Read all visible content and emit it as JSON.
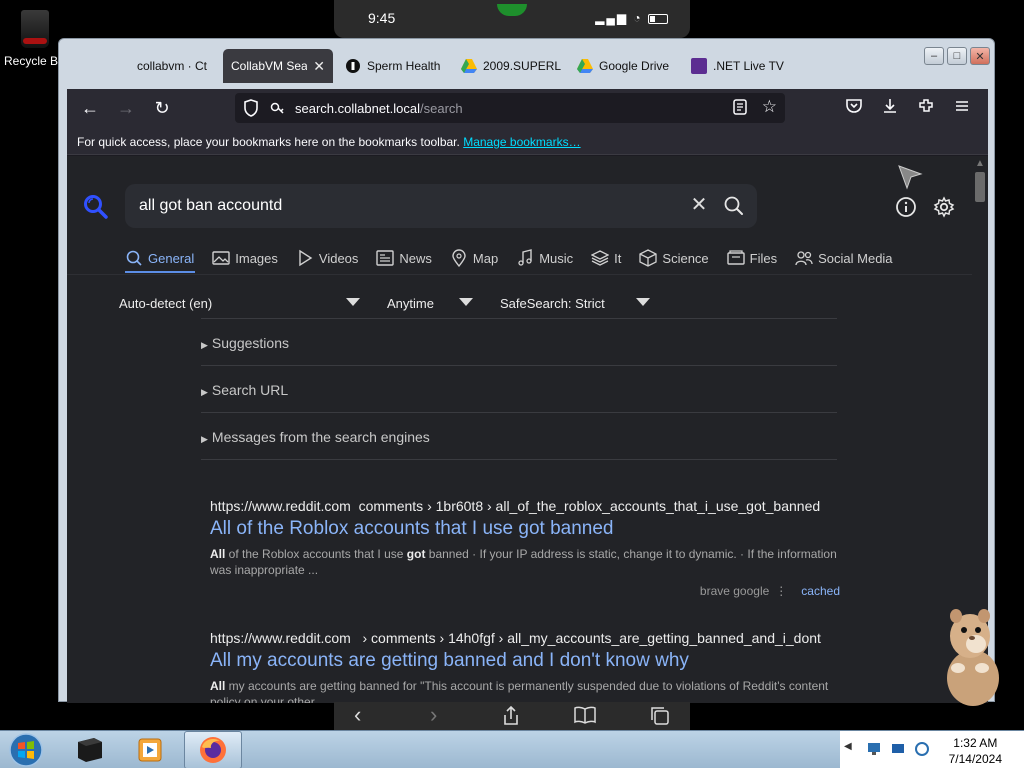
{
  "desktop": {
    "recycle_label": "Recycle Bin"
  },
  "phone": {
    "time": "9:45",
    "signal": "▂▄▆ ◔"
  },
  "tabs": [
    {
      "label": "collabvm · Ct",
      "icon": "user-icon"
    },
    {
      "label": "CollabVM Sear",
      "icon": "none"
    },
    {
      "label": "Sperm Health",
      "icon": "health-icon"
    },
    {
      "label": "2009.SUPERL",
      "icon": "google-drive-icon"
    },
    {
      "label": "Google Drive",
      "icon": "google-drive-icon"
    },
    {
      "label": ".NET Live TV",
      "icon": "net-icon"
    }
  ],
  "window_controls": {
    "minimize": "–",
    "maximize": "□",
    "close": "✕"
  },
  "nav": {
    "back": "←",
    "forward": "→",
    "reload": "↻"
  },
  "url": {
    "host": "search.collabnet.local",
    "path": "/search"
  },
  "bookmarks_bar": {
    "message": "For quick access, place your bookmarks here on the bookmarks toolbar.",
    "link": "Manage bookmarks…"
  },
  "search": {
    "query": "all got ban accountd"
  },
  "categories": [
    {
      "label": "General",
      "icon": "search-icon",
      "active": true
    },
    {
      "label": "Images",
      "icon": "image-icon"
    },
    {
      "label": "Videos",
      "icon": "play-icon"
    },
    {
      "label": "News",
      "icon": "newspaper-icon"
    },
    {
      "label": "Map",
      "icon": "map-pin-icon"
    },
    {
      "label": "Music",
      "icon": "music-icon"
    },
    {
      "label": "It",
      "icon": "layers-icon"
    },
    {
      "label": "Science",
      "icon": "cube-icon"
    },
    {
      "label": "Files",
      "icon": "file-icon"
    },
    {
      "label": "Social Media",
      "icon": "people-icon"
    }
  ],
  "filters": {
    "language": "Auto-detect (en)",
    "time": "Anytime",
    "safesearch": "SafeSearch: Strict"
  },
  "folds": [
    "Suggestions",
    "Search URL",
    "Messages from the search engines"
  ],
  "results": [
    {
      "url_host": "https://www.reddit.com",
      "url_path": "comments › 1br60t8 › all_of_the_roblox_accounts_that_i_use_got_banned",
      "title": "All of the Roblox accounts that I use got banned",
      "snip_b1": "All",
      "snip_t1": " of the Roblox accounts that I use ",
      "snip_b2": "got",
      "snip_t2": " banned · If your IP address is static, change it to dynamic. · If the information was inappropriate ...",
      "engines": "brave  google",
      "cached": "cached"
    },
    {
      "url_host": "https://www.reddit.com",
      "url_path": "› comments › 14h0fgf › all_my_accounts_are_getting_banned_and_i_dont",
      "title": "All my accounts are getting banned and I don't know why",
      "snip_b1": "All",
      "snip_t1": " my accounts are getting banned for \"This account is permanently suspended due to violations of Reddit's content policy on your other ..."
    }
  ],
  "phone_bottom": {
    "back": "‹",
    "forward": "›"
  },
  "taskbar": {
    "time": "1:32 AM",
    "date": "7/14/2024"
  },
  "colors": {
    "link": "#8ab4f8",
    "accent": "#5c8ee6",
    "page_bg": "#222327"
  }
}
